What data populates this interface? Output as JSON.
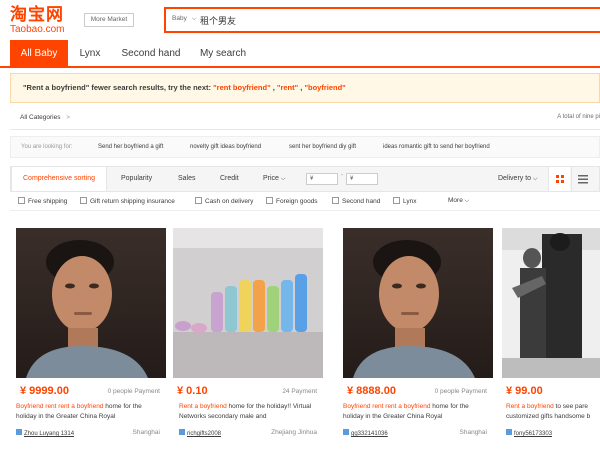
{
  "header": {
    "logo_cn": "淘宝网",
    "logo_en": "Taobao.com",
    "more_market": "More Market",
    "search_scope": "Baby",
    "search_value": "租个男友"
  },
  "tabs": [
    {
      "label": "All Baby",
      "active": true
    },
    {
      "label": "Lynx",
      "active": false
    },
    {
      "label": "Second hand",
      "active": false
    },
    {
      "label": "My search",
      "active": false
    }
  ],
  "notice": {
    "prefix": "\"Rent a boyfriend\" fewer search results, try the next: ",
    "s1": "\"rent boyfriend\"",
    "sep1": " , ",
    "s2": "\"rent\"",
    "sep2": " , ",
    "s3": "\"boyfriend\""
  },
  "categories": {
    "label": "All Categories",
    "chevron": ">",
    "total": "A total of nine pi"
  },
  "looking_for": {
    "label": "You are looking for:",
    "suggestions": [
      "Send her boyfriend a gift",
      "novelty gift ideas boyfriend",
      "sent her boyfriend diy gift",
      "ideas romantic gift to send her boyfriend"
    ]
  },
  "sort": {
    "items": [
      "Comprehensive sorting",
      "Popularity",
      "Sales",
      "Credit",
      "Price"
    ],
    "price_from": "¥",
    "price_to": "¥",
    "dash": "-",
    "delivery": "Delivery to"
  },
  "filters": [
    "Free shipping",
    "Gift return shipping insurance",
    "Cash on delivery",
    "Foreign goods",
    "Second hand",
    "Lynx",
    "More"
  ],
  "products": [
    {
      "price": "¥ 9999.00",
      "payment": "0 people Payment",
      "t_red1": "Boyfriend",
      "t_red2": " rent ",
      "t_red3": "rent a boyfriend",
      "t_rest": " home for the holiday in the Greater China Royal",
      "shop": "Zhou Luyang 1314",
      "location": "Shanghai"
    },
    {
      "price": "¥ 0.10",
      "payment": "24 Payment",
      "t_red1": "",
      "t_red2": "",
      "t_red3": "Rent a boyfriend",
      "t_rest": " home for the holiday!! Virtual Networks secondary male and",
      "shop": "richgifts2008",
      "location": "Zhejiang Jinhua"
    },
    {
      "price": "¥ 8888.00",
      "payment": "0 people Payment",
      "t_red1": "Boyfriend",
      "t_red2": " rent ",
      "t_red3": "rent a boyfriend",
      "t_rest": " home for the holiday in the Greater China Royal",
      "shop": "gg332141036",
      "location": "Shanghai"
    },
    {
      "price": "¥ 99.00",
      "payment": "0 people",
      "t_red1": "",
      "t_red2": "",
      "t_red3": "Rent a boyfriend",
      "t_rest": " to see pare customized gifts handsome b",
      "shop": "fony56173303",
      "location": ""
    }
  ],
  "colors": {
    "accent": "#ff4400",
    "notice_bg": "#fff8e6"
  },
  "icons": [
    "chevron-down-icon",
    "grid-view-icon",
    "list-view-icon",
    "shop-icon",
    "checkbox-icon"
  ]
}
